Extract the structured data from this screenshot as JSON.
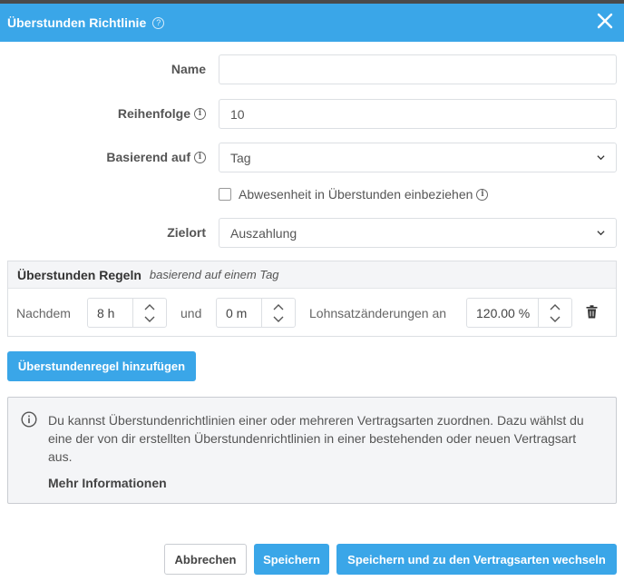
{
  "modal": {
    "title": "Überstunden Richtlinie",
    "help_icon": "question-circle-icon",
    "close_icon": "close-icon"
  },
  "form": {
    "name": {
      "label": "Name",
      "value": ""
    },
    "order": {
      "label": "Reihenfolge",
      "value": "10",
      "icon": "info-icon"
    },
    "based_on": {
      "label": "Basierend auf",
      "value": "Tag",
      "icon": "info-icon"
    },
    "include_absence": {
      "label": "Abwesenheit in Überstunden einbeziehen",
      "checked": false,
      "icon": "info-icon"
    },
    "destination": {
      "label": "Zielort",
      "value": "Auszahlung"
    }
  },
  "rules": {
    "title": "Überstunden Regeln",
    "subtitle": "basierend auf einem Tag",
    "row": {
      "after_label": "Nachdem",
      "hours": "8 h",
      "and_label": "und",
      "minutes": "0 m",
      "rate_label": "Lohnsatzänderungen an",
      "rate": "120.00 %",
      "delete_icon": "trash-icon"
    }
  },
  "add_rule_button": "Überstundenregel hinzufügen",
  "info": {
    "icon": "info-icon",
    "text": "Du kannst Überstundenrichtlinien einer oder mehreren Vertragsarten zuordnen. Dazu wählst du eine der von dir erstellten Überstundenrichtlinien in einer bestehenden oder neuen Vertragsart aus.",
    "more": "Mehr Informationen"
  },
  "footer": {
    "cancel": "Abbrechen",
    "save": "Speichern",
    "save_and_switch": "Speichern und zu den Vertragsarten wechseln"
  },
  "colors": {
    "primary": "#3aa6e8",
    "panel_bg": "#f4f5f7",
    "border": "#dcdfe3"
  }
}
